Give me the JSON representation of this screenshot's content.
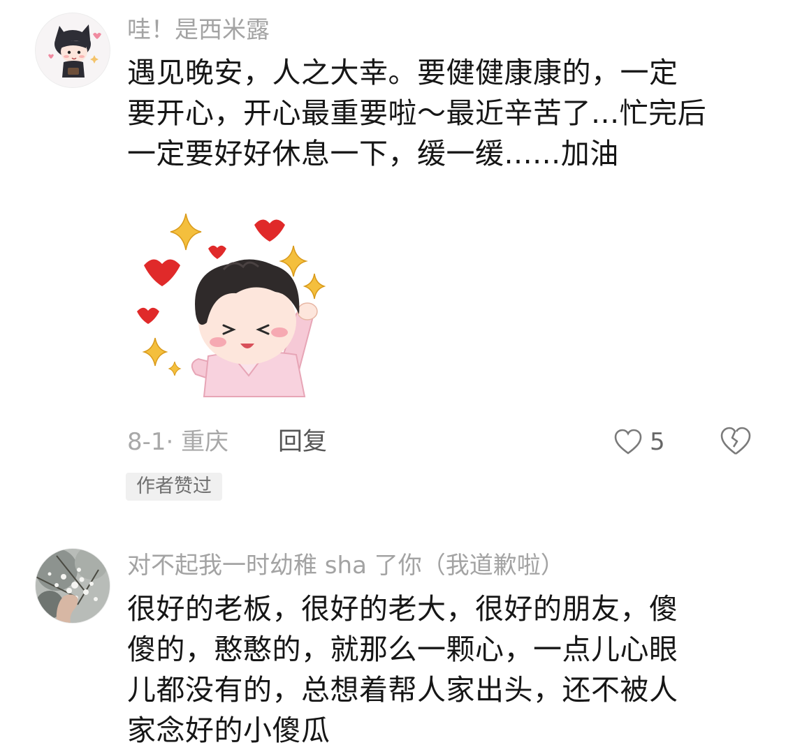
{
  "comments": [
    {
      "username": "哇！是西米露",
      "text_lines": [
        "遇见晚安，人之大幸。要健健康康的，一定",
        "要开心，开心最重要啦～最近辛苦了...忙完后",
        "一定要好好休息一下，缓一缓......加油"
      ],
      "date_location": "8-1· 重庆",
      "reply_label": "回复",
      "like_count": "5",
      "author_badge": "作者赞过",
      "icons": [
        "avatar-cartoon-cat-boy",
        "sticker-cheering-boy-hearts",
        "heart-outline-icon",
        "broken-heart-icon"
      ]
    },
    {
      "username": "对不起我一时幼稚 sha 了你（我道歉啦）",
      "text_lines": [
        "很好的老板，很好的老大，很好的朋友，傻",
        "傻的，憨憨的，就那么一颗心，一点儿心眼",
        "儿都没有的，总想着帮人家出头，还不被人",
        "家念好的小傻瓜"
      ],
      "icons": [
        "avatar-hand-with-blossoms"
      ]
    }
  ],
  "colors": {
    "username": "#a3a3a3",
    "content": "#161616",
    "meta": "#a8a8a8",
    "badge_bg": "#f0f0f0",
    "heart_red": "#e02a2a",
    "sparkle_gold": "#f2b83a"
  }
}
